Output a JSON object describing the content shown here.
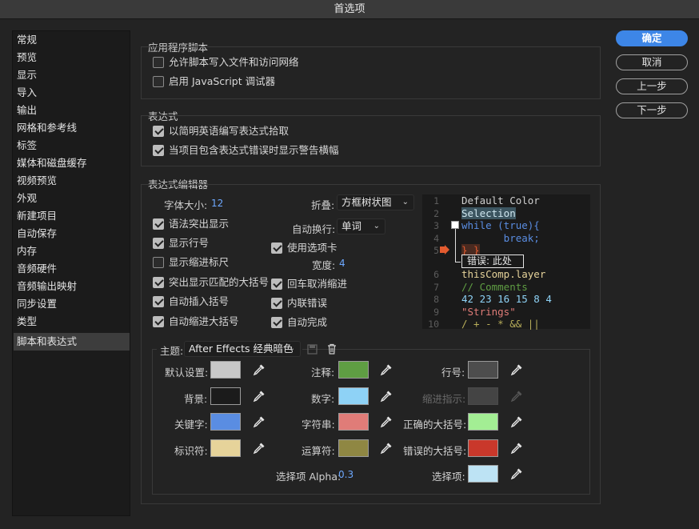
{
  "window": {
    "title": "首选项"
  },
  "sidebar": {
    "items": [
      {
        "label": "常规"
      },
      {
        "label": "预览"
      },
      {
        "label": "显示"
      },
      {
        "label": "导入"
      },
      {
        "label": "输出"
      },
      {
        "label": "网格和参考线"
      },
      {
        "label": "标签"
      },
      {
        "label": "媒体和磁盘缓存"
      },
      {
        "label": "视频预览"
      },
      {
        "label": "外观"
      },
      {
        "label": "新建项目"
      },
      {
        "label": "自动保存"
      },
      {
        "label": "内存"
      },
      {
        "label": "音频硬件"
      },
      {
        "label": "音频输出映射"
      },
      {
        "label": "同步设置"
      },
      {
        "label": "类型"
      },
      {
        "label": "脚本和表达式",
        "selected": true
      }
    ]
  },
  "buttons": {
    "ok": "确定",
    "cancel": "取消",
    "prev": "上一步",
    "next": "下一步"
  },
  "app_scripts": {
    "title": "应用程序脚本",
    "allow_write": {
      "label": "允许脚本写入文件和访问网络",
      "checked": false
    },
    "enable_debugger": {
      "label": "启用 JavaScript 调试器",
      "checked": false
    }
  },
  "expressions": {
    "title": "表达式",
    "plain_english": {
      "label": "以简明英语编写表达式拾取",
      "checked": true
    },
    "warning_banner": {
      "label": "当项目包含表达式错误时显示警告横幅",
      "checked": true
    }
  },
  "editor": {
    "title": "表达式编辑器",
    "font_size_label": "字体大小:",
    "font_size_value": "12",
    "fold_label": "折叠:",
    "fold_value": "方框树状图",
    "wrap_label": "自动换行:",
    "wrap_value": "单词",
    "syntax_highlight": {
      "label": "语法突出显示",
      "checked": true
    },
    "line_numbers": {
      "label": "显示行号",
      "checked": true
    },
    "indent_guides": {
      "label": "显示缩进标尺",
      "checked": false
    },
    "match_brackets": {
      "label": "突出显示匹配的大括号",
      "checked": true
    },
    "auto_brackets": {
      "label": "自动插入括号",
      "checked": true
    },
    "auto_indent": {
      "label": "自动缩进大括号",
      "checked": true
    },
    "use_tabs": {
      "label": "使用选项卡",
      "checked": true
    },
    "width_label": "宽度:",
    "width_value": "4",
    "enter_cancel": {
      "label": "回车取消缩进",
      "checked": true
    },
    "inline_errors": {
      "label": "内联错误",
      "checked": true
    },
    "autocomplete": {
      "label": "自动完成",
      "checked": true
    }
  },
  "code_preview": {
    "lines": [
      {
        "n": "1",
        "text": "Default Color"
      },
      {
        "n": "2",
        "text": "Selection"
      },
      {
        "n": "3",
        "text": "while (true){"
      },
      {
        "n": "4",
        "text": "       break;"
      },
      {
        "n": "5",
        "text": "} }"
      },
      {
        "n": "",
        "text": "错误: 此处"
      },
      {
        "n": "6",
        "text": "thisComp.layer"
      },
      {
        "n": "7",
        "text": "// Comments"
      },
      {
        "n": "8",
        "text": "42 23 16 15 8 4"
      },
      {
        "n": "9",
        "text": "\"Strings\""
      },
      {
        "n": "10",
        "text": "/ + - * && ||"
      }
    ]
  },
  "theme": {
    "label": "主题:",
    "value": "After Effects 经典暗色",
    "colors": [
      {
        "label": "默认设置:",
        "color": "#c8c8c8"
      },
      {
        "label": "背景:",
        "color": "#1b1b1b"
      },
      {
        "label": "关键字:",
        "color": "#5a8de2"
      },
      {
        "label": "标识符:",
        "color": "#e6d39a"
      },
      {
        "label": "注释:",
        "color": "#5f9e43"
      },
      {
        "label": "数字:",
        "color": "#8ed2f6"
      },
      {
        "label": "字符串:",
        "color": "#e07c78"
      },
      {
        "label": "运算符:",
        "color": "#8f8743"
      },
      {
        "label": "行号:",
        "color": "#4d4d4d"
      },
      {
        "label": "缩进指示:",
        "color": "#444444",
        "disabled": true
      },
      {
        "label": "正确的大括号:",
        "color": "#a3ee94"
      },
      {
        "label": "错误的大括号:",
        "color": "#c9382b"
      },
      {
        "label": "选择项:",
        "color": "#bde3f4"
      }
    ],
    "selection_alpha_label": "选择项 Alpha:",
    "selection_alpha_value": "0.3"
  },
  "icons": {
    "eyedropper": "eyedropper-icon",
    "trash": "trash-icon",
    "save": "save-theme-icon",
    "error_arrow": "error-arrow-icon"
  },
  "accent": "#3d86e7"
}
